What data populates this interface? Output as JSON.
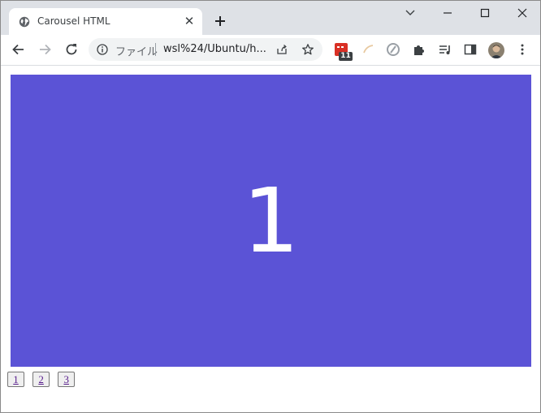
{
  "browser": {
    "tab": {
      "title": "Carousel HTML",
      "close_glyph": "✕"
    },
    "omnibox": {
      "site_label": "ファイル",
      "url": "wsl%24/Ubuntu/h..."
    },
    "extension_badge": "11",
    "colors": {
      "tabstrip": "#dee1e6",
      "omnibox": "#f1f3f4",
      "accent_red": "#d93025"
    }
  },
  "carousel": {
    "current_slide": "1",
    "slide_color": "#5b53d6",
    "nav_links": [
      "1",
      "2",
      "3"
    ]
  }
}
